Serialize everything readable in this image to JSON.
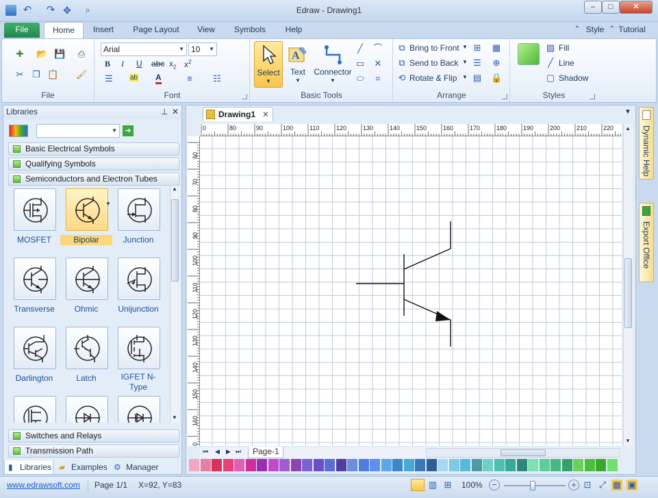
{
  "window": {
    "title": "Edraw - Drawing1"
  },
  "tabs": {
    "file": "File",
    "home": "Home",
    "insert": "Insert",
    "page_layout": "Page Layout",
    "view": "View",
    "symbols": "Symbols",
    "help": "Help"
  },
  "top_right": {
    "style": "Style",
    "tutorial": "Tutorial"
  },
  "ribbon": {
    "file_group": "File",
    "font_group": "Font",
    "font_name": "Arial",
    "font_size": "10",
    "basic_tools_group": "Basic Tools",
    "select": "Select",
    "text": "Text",
    "connector": "Connector",
    "arrange_group": "Arrange",
    "bring_to_front": "Bring to Front",
    "send_to_back": "Send to Back",
    "rotate_flip": "Rotate & Flip",
    "styles_group": "Styles",
    "fill": "Fill",
    "line": "Line",
    "shadow": "Shadow"
  },
  "libraries": {
    "title": "Libraries",
    "categories_top": [
      "Basic Electrical Symbols",
      "Qualifying Symbols",
      "Semiconductors and Electron Tubes"
    ],
    "categories_bottom": [
      "Switches and Relays",
      "Transmission Path"
    ],
    "shapes": [
      "MOSFET",
      "Bipolar",
      "Junction",
      "Transverse",
      "Ohmic",
      "Unijunction",
      "Darlington",
      "Latch",
      "IGFET N-Type"
    ],
    "selected_shape": "Bipolar",
    "bottom_tabs": [
      "Libraries",
      "Examples",
      "Manager"
    ]
  },
  "document": {
    "tab": "Drawing1",
    "page_tab": "Page-1",
    "ruler_h": [
      "0",
      "80",
      "90",
      "100",
      "110",
      "120",
      "130",
      "140",
      "150",
      "160",
      "170",
      "180",
      "190",
      "200",
      "210",
      "220"
    ],
    "ruler_v": [
      "60",
      "70",
      "80",
      "90",
      "100",
      "110",
      "120",
      "130",
      "140",
      "150",
      "160",
      "170"
    ]
  },
  "right_panels": {
    "dynamic_help": "Dynamic Help",
    "export_office": "Export Office"
  },
  "palette": [
    "#f2a7c1",
    "#e57fa3",
    "#d8325a",
    "#e8407a",
    "#e060b8",
    "#cf2f9a",
    "#9b2fae",
    "#c04ac8",
    "#a05cd6",
    "#8e44ad",
    "#7b5fd6",
    "#6a4fc2",
    "#5c6bd8",
    "#4e3f9e",
    "#6b8fe0",
    "#4f7de0",
    "#5b90f0",
    "#5ea6e8",
    "#3e86c8",
    "#4aa8d8",
    "#3b78b8",
    "#2e5e98",
    "#a8d8f0",
    "#7ec8e8",
    "#5ab8d8",
    "#4a9aa8",
    "#6fd0c8",
    "#4ec0b0",
    "#38a898",
    "#2e8878",
    "#7ee0b0",
    "#5ccf98",
    "#48b880",
    "#34a068",
    "#6ccf5a",
    "#4cbf3a",
    "#3aa82c",
    "#72e070"
  ],
  "status": {
    "link": "www.edrawsoft.com",
    "page": "Page 1/1",
    "coords": "X=92, Y=83",
    "zoom": "100%"
  }
}
